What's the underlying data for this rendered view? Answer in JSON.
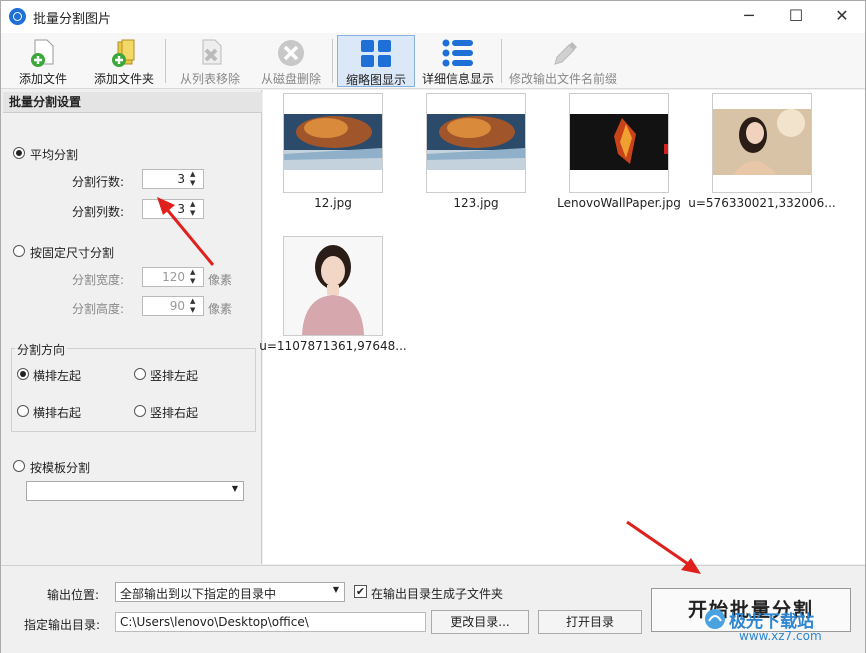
{
  "window": {
    "title": "批量分割图片",
    "minimize": "─",
    "maximize": "☐",
    "close": "✕"
  },
  "toolbar": {
    "add_file": "添加文件",
    "add_folder": "添加文件夹",
    "remove_from_list": "从列表移除",
    "delete_from_disk": "从磁盘删除",
    "thumbnail_view": "缩略图显示",
    "detail_view": "详细信息显示",
    "rename_prefix": "修改输出文件名前缀"
  },
  "settings": {
    "title": "批量分割设置",
    "even_split": "平均分割",
    "rows_label": "分割行数:",
    "rows_value": "3",
    "cols_label": "分割列数:",
    "cols_value": "3",
    "fixed_size": "按固定尺寸分割",
    "width_label": "分割宽度:",
    "width_value": "120",
    "height_label": "分割高度:",
    "height_value": "90",
    "unit": "像素",
    "direction_title": "分割方向",
    "dir_h_left": "横排左起",
    "dir_v_left": "竖排左起",
    "dir_h_right": "横排右起",
    "dir_v_right": "竖排右起",
    "template": "按模板分割",
    "template_value": ""
  },
  "files": [
    {
      "name": "12.jpg"
    },
    {
      "name": "123.jpg"
    },
    {
      "name": "LenovoWallPaper.jpg"
    },
    {
      "name": "u=576330021,332006..."
    },
    {
      "name": "u=1107871361,97648..."
    }
  ],
  "output": {
    "location_label": "输出位置:",
    "location_value": "全部输出到以下指定的目录中",
    "subfolder_label": "在输出目录生成子文件夹",
    "subfolder_checked": true,
    "dir_label": "指定输出目录:",
    "dir_value": "C:\\Users\\lenovo\\Desktop\\office\\",
    "change_dir": "更改目录...",
    "open_dir": "打开目录",
    "start": "开始批量分割"
  },
  "watermark": {
    "text": "极光下载站",
    "url": "www.xz7.com"
  },
  "colors": {
    "accent": "#1e6fd6",
    "arrow": "#e0201c"
  }
}
